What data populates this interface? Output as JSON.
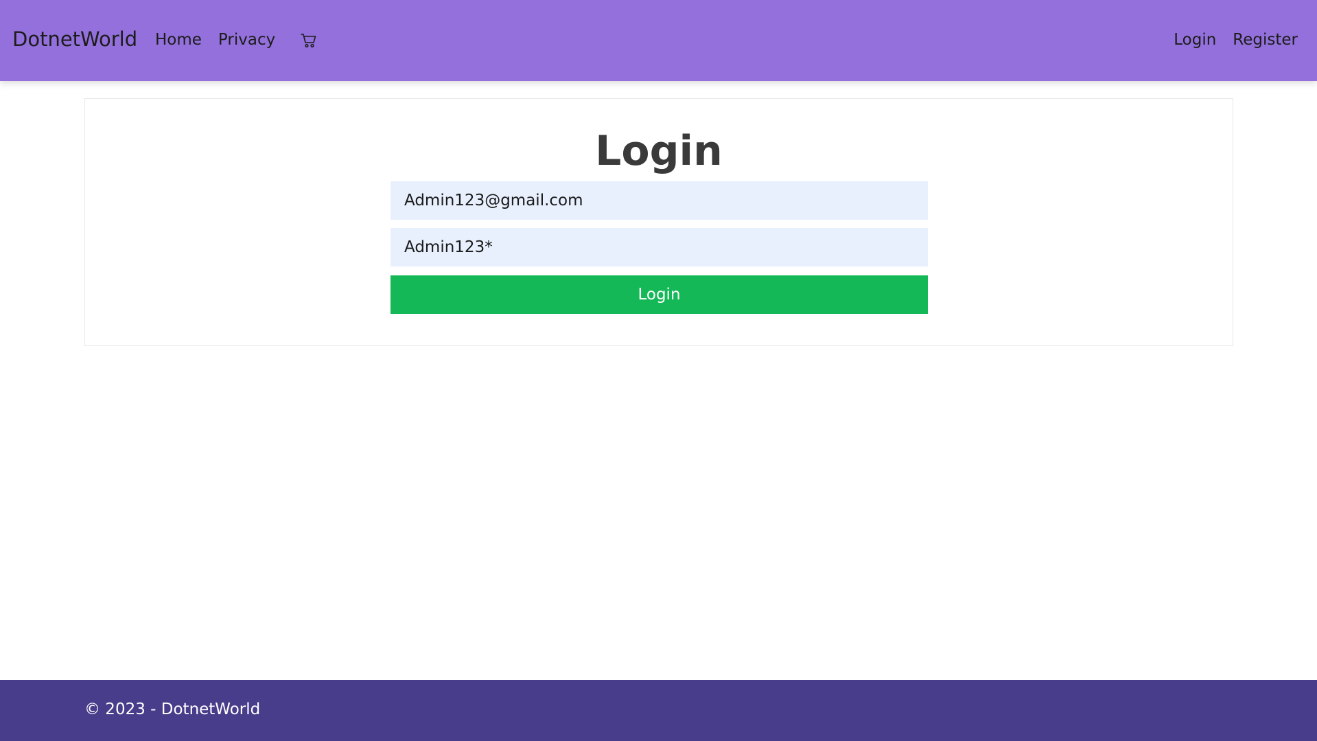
{
  "navbar": {
    "brand": "DotnetWorld",
    "links": [
      "Home",
      "Privacy"
    ],
    "cart_icon": "cart-icon",
    "right_links": [
      "Login",
      "Register"
    ],
    "background": "#9370db"
  },
  "login": {
    "title": "Login",
    "email_value": "Admin123@gmail.com",
    "password_value": "Admin123*",
    "submit_label": "Login",
    "field_background": "#e8f0fe",
    "submit_color": "#15b857"
  },
  "footer": {
    "text": "© 2023 - DotnetWorld",
    "background": "#483d8b"
  }
}
